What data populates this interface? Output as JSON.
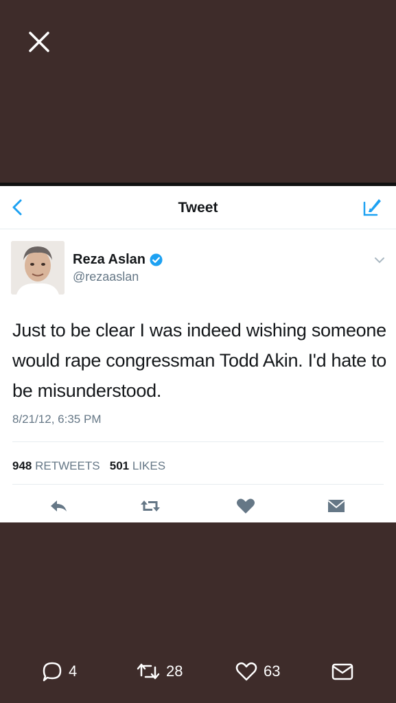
{
  "overlay": {
    "close_icon": "close-icon"
  },
  "nav": {
    "title": "Tweet",
    "back_icon": "chevron-left-icon",
    "compose_icon": "compose-tweet-icon",
    "accent": "#1da1f2"
  },
  "tweet": {
    "author_name": "Reza Aslan",
    "handle": "@rezaaslan",
    "verified": true,
    "text": "Just to be clear I was indeed wishing someone would rape congressman Todd Akin. I'd hate to be misunderstood.",
    "timestamp": "8/21/12, 6:35 PM",
    "retweets_count": "948",
    "retweets_label": "RETWEETS",
    "likes_count": "501",
    "likes_label": "LIKES"
  },
  "actions": [
    "reply-icon",
    "retweet-icon",
    "like-icon",
    "direct-message-icon"
  ],
  "bottom_bar": {
    "replies": "4",
    "retweets": "28",
    "likes": "63"
  }
}
